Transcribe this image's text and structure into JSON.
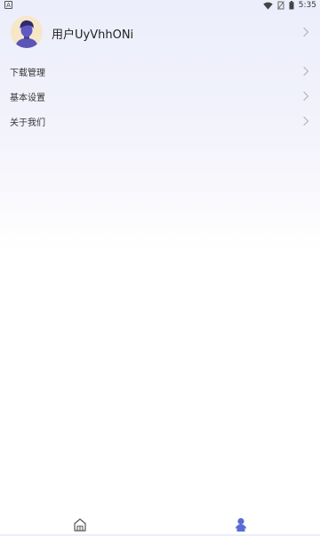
{
  "status_bar": {
    "notification_glyph": "A",
    "time": "5:35",
    "icons": [
      "wifi-icon",
      "no-sim-icon",
      "battery-icon"
    ]
  },
  "profile": {
    "username": "用户UyVhhONi",
    "avatar": "avatar"
  },
  "menu": {
    "items": [
      {
        "label": "下载管理"
      },
      {
        "label": "基本设置"
      },
      {
        "label": "关于我们"
      }
    ]
  },
  "tab_bar": {
    "tabs": [
      {
        "icon": "home-icon",
        "active": false
      },
      {
        "icon": "profile-icon",
        "active": true
      }
    ],
    "active_color": "#5b6bd6",
    "inactive_color": "#555555"
  }
}
